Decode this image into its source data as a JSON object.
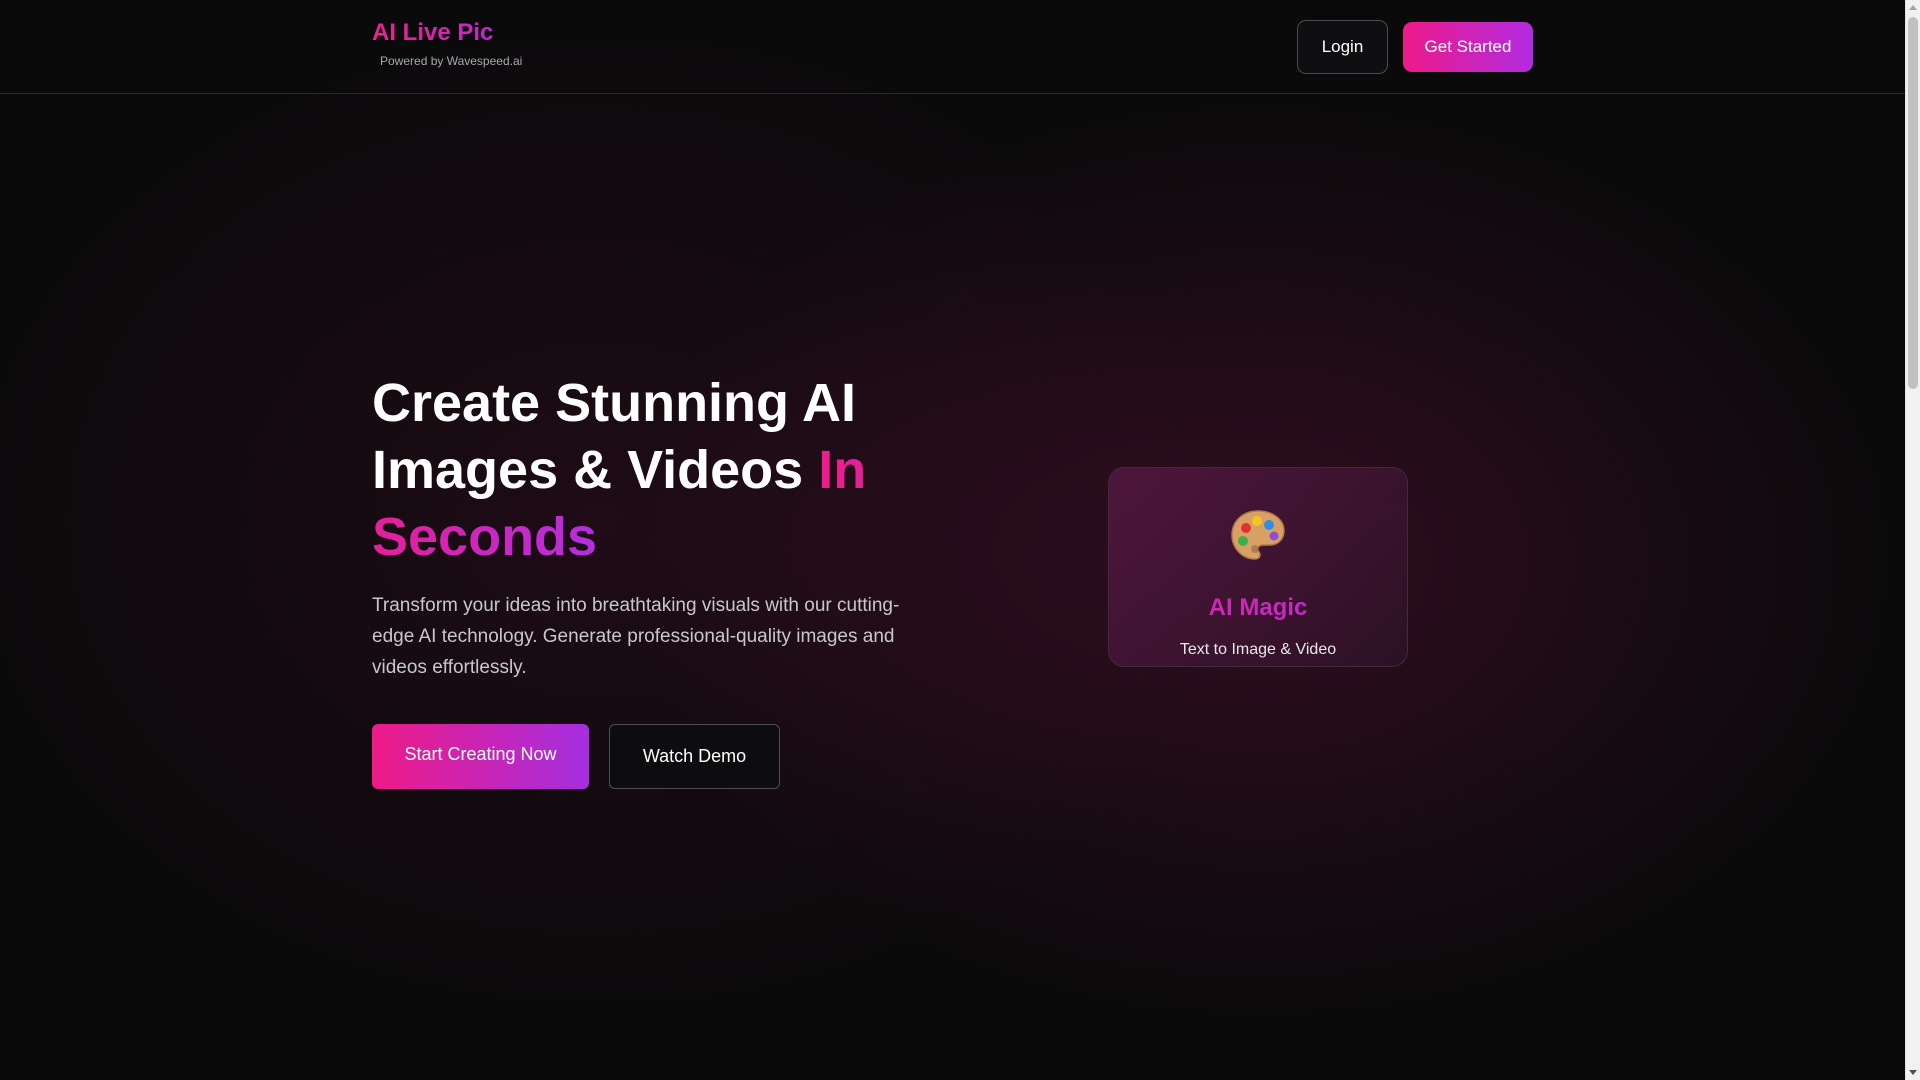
{
  "header": {
    "brand_title": "AI Live Pic",
    "brand_subtitle": "Powered by Wavespeed.ai",
    "login_label": "Login",
    "get_started_label": "Get Started"
  },
  "hero": {
    "title_main": "Create Stunning AI Images & Videos ",
    "title_accent": "In Seconds",
    "description": "Transform your ideas into breathtaking visuals with our cutting-edge AI technology. Generate professional-quality images and videos effortlessly.",
    "start_button_label": "Start Creating Now",
    "demo_button_label": "Watch Demo"
  },
  "card": {
    "icon": "artist-palette-icon",
    "title": "AI Magic",
    "subtitle": "Text to Image & Video"
  },
  "colors": {
    "background": "#0b0a0b",
    "accent_pink": "#ee1a8a",
    "accent_purple": "#b12bdf",
    "text_muted": "#c8c8cc"
  },
  "scrollbar": {
    "position_fraction": 0
  }
}
